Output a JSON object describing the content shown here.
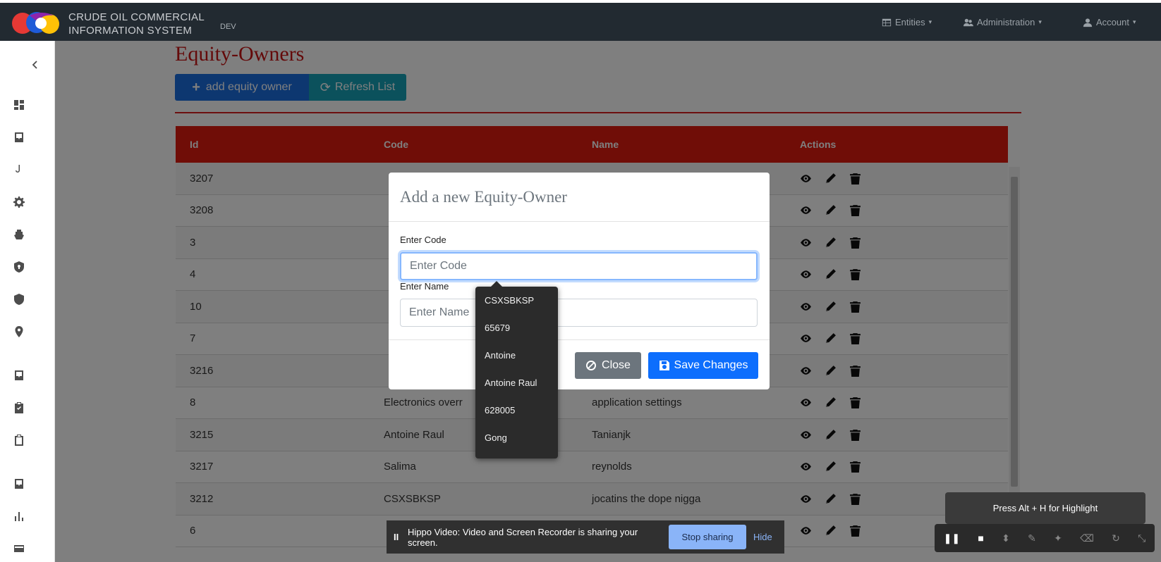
{
  "header": {
    "brand_line1": "CRUDE OIL COMMERCIAL",
    "brand_line2": "INFORMATION SYSTEM",
    "env": "DEV",
    "menus": [
      {
        "label": "Entities",
        "icon": "table-icon"
      },
      {
        "label": "Administration",
        "icon": "users-icon"
      },
      {
        "label": "Account",
        "icon": "user-icon"
      }
    ]
  },
  "sidebar": {
    "collapse_icon": "chevron-left-icon",
    "items": [
      "dashboard-icon",
      "inbox-icon",
      "hook-icon",
      "gear-icon",
      "ship-icon",
      "shield-lock-icon",
      "shield-icon",
      "location-pin-icon",
      "inbox-download-icon",
      "clipboard-check-icon",
      "clipboard-icon",
      "inbox-download-icon",
      "bar-chart-icon",
      "card-icon"
    ]
  },
  "main": {
    "title": "Equity-Owners",
    "add_button": "add equity owner",
    "refresh_button": "Refresh List",
    "table": {
      "headers": [
        "Id",
        "Code",
        "Name",
        "Actions"
      ],
      "rows": [
        {
          "id": "3207",
          "code": "",
          "name": ""
        },
        {
          "id": "3208",
          "code": "",
          "name": ""
        },
        {
          "id": "3",
          "code": "",
          "name": ""
        },
        {
          "id": "4",
          "code": "",
          "name": ""
        },
        {
          "id": "10",
          "code": "",
          "name": ""
        },
        {
          "id": "7",
          "code": "",
          "name": ""
        },
        {
          "id": "3216",
          "code": "",
          "name": ""
        },
        {
          "id": "8",
          "code": "Electronics overr",
          "name": "application settings"
        },
        {
          "id": "3215",
          "code": "Antoine Raul",
          "name": "Tanianjk"
        },
        {
          "id": "3217",
          "code": "Salima",
          "name": "reynolds"
        },
        {
          "id": "3212",
          "code": "CSXSBKSP",
          "name": "jocatins the dope nigga"
        },
        {
          "id": "6",
          "code": "",
          "name": ""
        }
      ]
    }
  },
  "modal": {
    "title": "Add a new Equity-Owner",
    "code_label": "Enter Code",
    "code_placeholder": "Enter Code",
    "name_label": "Enter Name",
    "name_placeholder": "Enter Name",
    "close_button": "Close",
    "save_button": "Save Changes"
  },
  "autocomplete": {
    "items": [
      "CSXSBKSP",
      "65679",
      "Antoine",
      "Antoine Raul",
      "628005",
      "Gong"
    ]
  },
  "recorder": {
    "pause": "II",
    "message": "Hippo Video: Video and Screen Recorder is sharing your screen.",
    "stop_button": "Stop sharing",
    "hide_link": "Hide"
  },
  "highlight": {
    "hint": "Press Alt + H for Highlight"
  },
  "colors": {
    "navbar": "#222a31",
    "title_red": "#c81414",
    "table_header": "#e01a0f",
    "primary": "#0d6efd",
    "info": "#17a2b8",
    "secondary": "#6c757d"
  }
}
